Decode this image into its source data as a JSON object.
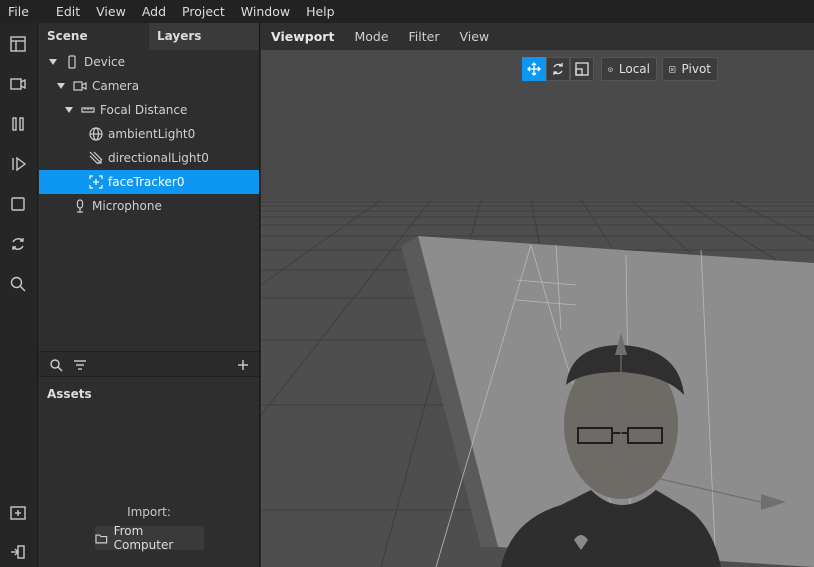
{
  "menu": [
    "File",
    "Edit",
    "View",
    "Add",
    "Project",
    "Window",
    "Help"
  ],
  "rail_tools": [
    "layout-icon",
    "video-camera-icon",
    "pause-icon",
    "play-step-icon",
    "stop-icon",
    "refresh-icon",
    "search-icon",
    "add-file-icon",
    "exit-icon"
  ],
  "scene_panel": {
    "tabs": [
      "Scene",
      "Layers"
    ],
    "tree": [
      {
        "label": "Device",
        "icon": "device-icon",
        "expanded": true
      },
      {
        "label": "Camera",
        "icon": "camera-icon",
        "expanded": true
      },
      {
        "label": "Focal Distance",
        "icon": "focal-distance-icon",
        "expanded": true
      },
      {
        "label": "ambientLight0",
        "icon": "globe-icon"
      },
      {
        "label": "directionalLight0",
        "icon": "directional-light-icon"
      },
      {
        "label": "faceTracker0",
        "icon": "face-tracker-icon",
        "selected": true
      },
      {
        "label": "Microphone",
        "icon": "microphone-icon"
      }
    ]
  },
  "assets": {
    "title": "Assets",
    "import_label": "Import:",
    "from_computer": "From Computer"
  },
  "viewport": {
    "tabs": [
      "Viewport",
      "Mode",
      "Filter",
      "View"
    ],
    "local_label": "Local",
    "pivot_label": "Pivot"
  },
  "colors": {
    "accent": "#0d96f2",
    "panel": "#2e2e2e",
    "viewport_bg": "#4a4a4a"
  }
}
